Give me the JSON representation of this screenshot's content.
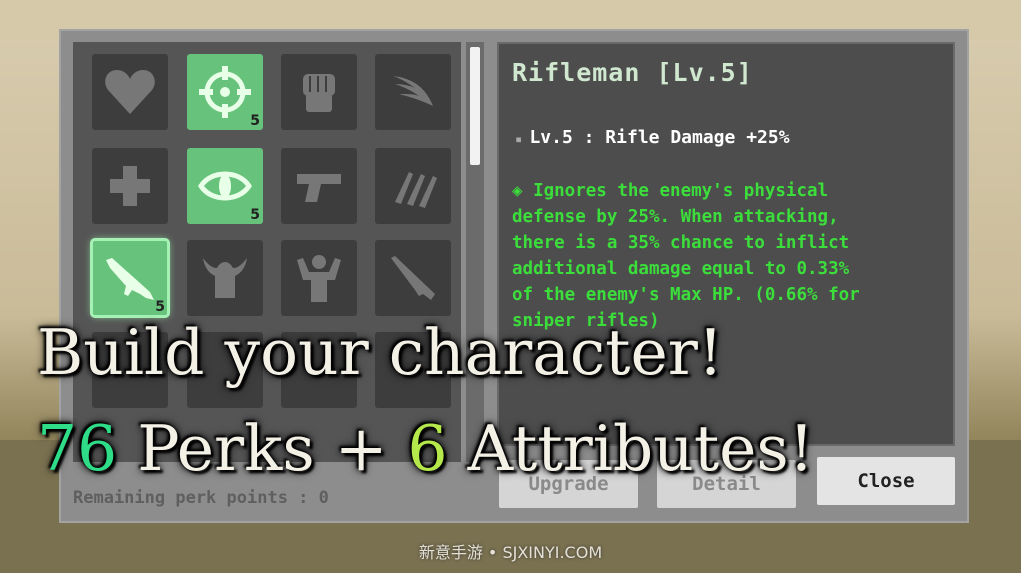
{
  "perk_grid": {
    "cells": [
      {
        "icon": "heart-icon",
        "state": "off",
        "level": ""
      },
      {
        "icon": "crosshair-icon",
        "state": "on",
        "level": "5"
      },
      {
        "icon": "fist-icon",
        "state": "off",
        "level": ""
      },
      {
        "icon": "wing-icon",
        "state": "off",
        "level": ""
      },
      {
        "icon": "medical-cross-icon",
        "state": "off",
        "level": ""
      },
      {
        "icon": "eye-icon",
        "state": "on",
        "level": "5"
      },
      {
        "icon": "pistol-icon",
        "state": "off",
        "level": ""
      },
      {
        "icon": "bullets-icon",
        "state": "off",
        "level": ""
      },
      {
        "icon": "rifle-icon",
        "state": "selected",
        "level": "5"
      },
      {
        "icon": "viking-helmet-icon",
        "state": "off",
        "level": ""
      },
      {
        "icon": "strongman-icon",
        "state": "off",
        "level": ""
      },
      {
        "icon": "shotgun-icon",
        "state": "off",
        "level": ""
      }
    ]
  },
  "perk_info": {
    "title": "Rifleman [Lv.5]",
    "level_line": "Lv.5 : Rifle Damage +25%",
    "description_lines": [
      "◈ Ignores the enemy's physical",
      "defense by 25%. When attacking,",
      "there is a 35% chance to inflict",
      "additional damage equal to 0.33%",
      "of the enemy's Max HP. (0.66% for",
      "sniper rifles)"
    ]
  },
  "footer": {
    "remaining": "Remaining perk points : 0",
    "upgrade_label": "Upgrade",
    "detail_label": "Detail",
    "close_label": "Close"
  },
  "promo": {
    "line1": "Build your character!",
    "count_perks": "76",
    "perks_word": " Perks + ",
    "count_attributes": "6",
    "attributes_word": " Attributes!"
  },
  "watermark": "新意手游 • SJXINYI.COM",
  "colors": {
    "active_cell": "#67c27c",
    "description": "#3bde3b",
    "accent_green": "#2fdc88",
    "accent_lime": "#b5e84b"
  }
}
